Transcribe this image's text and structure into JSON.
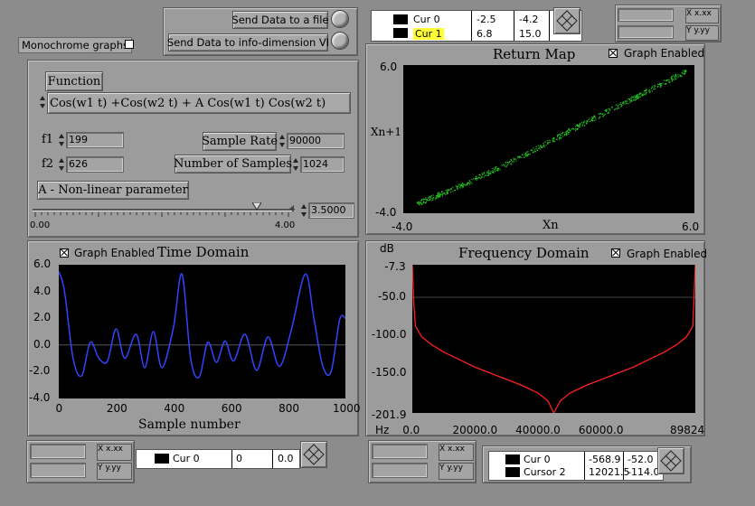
{
  "monochrome": {
    "label": "Monochrome graphs"
  },
  "send": {
    "file_label": "Send Data to a file",
    "info_label": "Send Data to info-dimension VI"
  },
  "function": {
    "label": "Function",
    "formula": "Cos(w1 t) +Cos(w2 t) + A Cos(w1 t) Cos(w2 t)",
    "f1_label": "f1",
    "f1_value": "199",
    "f2_label": "f2",
    "f2_value": "626",
    "sample_rate_label": "Sample Rate",
    "sample_rate_value": "90000",
    "num_samples_label": "Number of Samples",
    "num_samples_value": "1024",
    "a_label": "A - Non-linear parameter",
    "slider_min": "0.00",
    "slider_max": "4.00",
    "a_value": "3.5000",
    "a_level": 3.5
  },
  "top_cursor": {
    "rows": [
      {
        "name": "Cur 0",
        "x": "-2.5",
        "y": "-4.2"
      },
      {
        "name": "Cur 1",
        "x": "6.8",
        "y": "15.0"
      }
    ]
  },
  "scale_top": {
    "x_label": "X",
    "x_fmt": "x.xx",
    "y_label": "Y",
    "y_fmt": "y.yy"
  },
  "return_map": {
    "title": "Return Map",
    "graph_enabled": "Graph Enabled",
    "y_max": "6.0",
    "y_min": "-4.0",
    "y_label": "Xn+1",
    "x_min": "-4.0",
    "x_max": "6.0",
    "x_label": "Xn",
    "point_color": "#22c422"
  },
  "time_domain": {
    "title": "Time Domain",
    "graph_enabled": "Graph Enabled",
    "y_ticks": [
      "6.0",
      "4.0",
      "2.0",
      "0.0",
      "-2.0",
      "-4.0"
    ],
    "x_ticks": [
      "0",
      "200",
      "400",
      "600",
      "800",
      "1000"
    ],
    "x_label": "Sample number",
    "line_color": "#3344ff"
  },
  "freq_domain": {
    "title": "Frequency Domain",
    "graph_enabled": "Graph Enabled",
    "y_unit": "dB",
    "x_unit": "Hz",
    "y_ticks": [
      "-7.3",
      "-50.0",
      "-100.0",
      "-150.0",
      "-201.9"
    ],
    "x_ticks": [
      "0.0",
      "20000.0",
      "40000.0",
      "60000.0",
      "89824"
    ],
    "line_color": "#ff2020"
  },
  "bottom_left_scale": {
    "x_label": "X",
    "x_fmt": "x.xx",
    "y_label": "Y",
    "y_fmt": "y.yy"
  },
  "bottom_cursor1": {
    "rows": [
      {
        "name": "Cur 0",
        "x": "0",
        "y": "0.0"
      }
    ]
  },
  "bottom_mid_scale": {
    "x_label": "X",
    "x_fmt": "x.xx",
    "y_label": "Y",
    "y_fmt": "y.yy"
  },
  "bottom_cursor2": {
    "rows": [
      {
        "name": "Cur 0",
        "x": "-568.9",
        "y": "-52.0"
      },
      {
        "name": "Cursor 2",
        "x": "12021.5",
        "y": "-114.0"
      }
    ]
  },
  "chart_data": [
    {
      "type": "scatter",
      "title": "Return Map",
      "xlabel": "Xn",
      "ylabel": "Xn+1",
      "xlim": [
        -4.0,
        6.0
      ],
      "ylim": [
        -4.0,
        6.0
      ],
      "x": [
        -3.5,
        -2.0,
        0.0,
        2.0,
        4.0,
        5.7
      ],
      "y": [
        -3.3,
        -2.1,
        -0.2,
        1.9,
        3.9,
        5.6
      ]
    },
    {
      "type": "line",
      "title": "Time Domain",
      "xlabel": "Sample number",
      "ylabel": "",
      "xlim": [
        0,
        1000
      ],
      "ylim": [
        -4.0,
        6.0
      ],
      "x": [
        0,
        20,
        50,
        80,
        110,
        140,
        170,
        200,
        230,
        270,
        300,
        330,
        360,
        400,
        430,
        460,
        490,
        520,
        550,
        580,
        610,
        650,
        690,
        730,
        770,
        810,
        860,
        890,
        920,
        950,
        980,
        1000
      ],
      "y": [
        5.5,
        4.0,
        -1.0,
        -2.3,
        0.2,
        -1.0,
        -1.2,
        1.2,
        -1.0,
        0.8,
        -1.7,
        1.0,
        -1.7,
        1.3,
        5.3,
        -1.0,
        -2.4,
        0.2,
        -1.3,
        0.3,
        -1.2,
        0.8,
        -1.9,
        0.6,
        -1.6,
        1.0,
        5.3,
        2.0,
        -1.5,
        -2.0,
        1.9,
        2.0
      ]
    },
    {
      "type": "line",
      "title": "Frequency Domain",
      "xlabel": "Hz",
      "ylabel": "dB",
      "xlim": [
        0,
        89824
      ],
      "ylim": [
        -201.9,
        -7.3
      ],
      "x": [
        0,
        500,
        1000,
        3000,
        6000,
        10000,
        15000,
        20000,
        25000,
        30000,
        35000,
        40000,
        43000,
        44912,
        47000,
        50000,
        55000,
        60000,
        65000,
        70000,
        75000,
        80000,
        84000,
        87000,
        89000,
        89324,
        89824
      ],
      "y": [
        -7.3,
        -60,
        -88,
        -102,
        -112,
        -122,
        -132,
        -142,
        -150,
        -158,
        -166,
        -176,
        -186,
        -201.9,
        -186,
        -176,
        -166,
        -158,
        -150,
        -142,
        -132,
        -122,
        -112,
        -102,
        -88,
        -60,
        -7.3
      ]
    }
  ]
}
